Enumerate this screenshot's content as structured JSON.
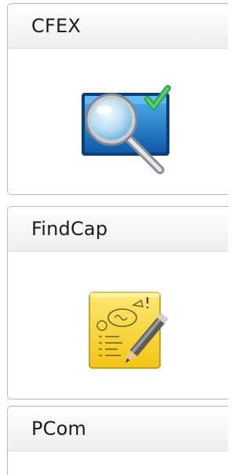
{
  "apps": [
    {
      "title": "CFEX",
      "icon": "magnifier-check-icon"
    },
    {
      "title": "FindCap",
      "icon": "note-pencil-icon"
    },
    {
      "title": "PCom",
      "icon": null
    }
  ],
  "colors": {
    "tile_border": "#b9b9b9",
    "header_light": "#ffffff",
    "header_dark": "#eeeeee",
    "title_text": "#1b1b1b",
    "monitor_blue": "#1e78c8",
    "check_green": "#2fa84a",
    "note_yellow": "#f7d22b"
  }
}
